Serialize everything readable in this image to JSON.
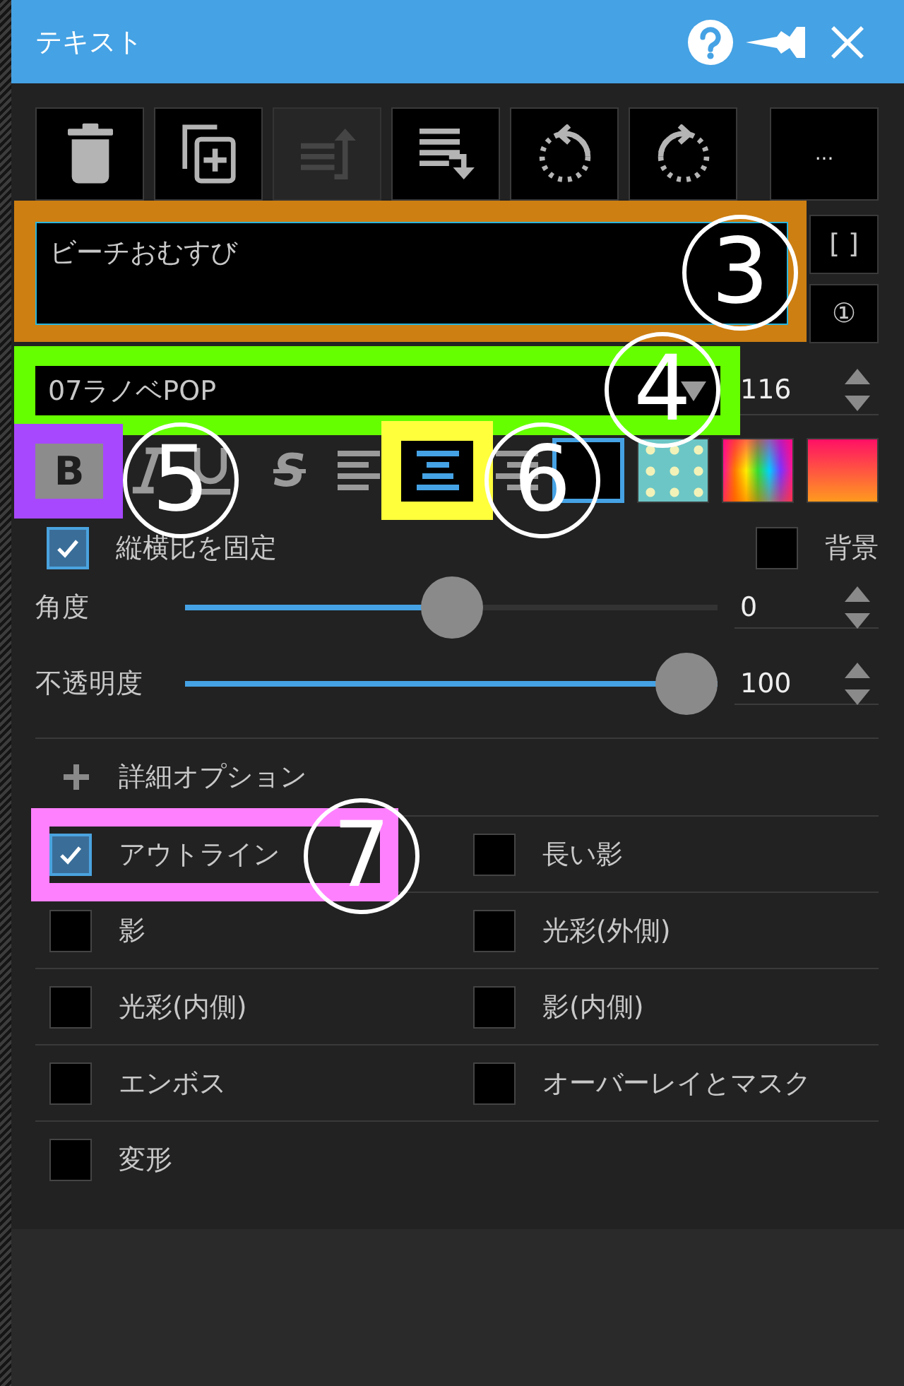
{
  "window": {
    "title": "テキスト"
  },
  "toolbar": {
    "buttons": [
      {
        "kind": "delete",
        "disabled": false
      },
      {
        "kind": "duplicate",
        "disabled": false
      },
      {
        "kind": "bring-forward",
        "disabled": true
      },
      {
        "kind": "send-backward",
        "disabled": false
      },
      {
        "kind": "rotate-left",
        "disabled": false
      },
      {
        "kind": "rotate-right",
        "disabled": false
      }
    ],
    "more": "..."
  },
  "text_input": {
    "value": "ビーチおむすび",
    "annotation": {
      "number": "3",
      "color": "#cd7f12"
    }
  },
  "side_buttons": [
    "[ ]",
    "①"
  ],
  "font": {
    "value": "07ラノベPOP",
    "size": "116",
    "annotation": {
      "number": "4",
      "color": "#66ff00"
    }
  },
  "style_buttons": [
    {
      "kind": "bold",
      "label": "B",
      "on": true,
      "annotation": {
        "number": "5",
        "color": "#a748ff"
      }
    },
    {
      "kind": "italic",
      "on": false
    },
    {
      "kind": "underline",
      "on": false
    },
    {
      "kind": "strikethrough",
      "label": "S",
      "on": false
    }
  ],
  "align_buttons": [
    {
      "kind": "left",
      "selected": false
    },
    {
      "kind": "center",
      "selected": true,
      "annotation": {
        "number": "6",
        "color": "#ffff3c"
      }
    },
    {
      "kind": "right",
      "selected": false
    }
  ],
  "fill_swatches": [
    {
      "kind": "solid",
      "selected": true
    },
    {
      "kind": "dots",
      "selected": false
    },
    {
      "kind": "rainbow",
      "selected": false
    },
    {
      "kind": "gradient",
      "selected": false
    }
  ],
  "lock_aspect": {
    "label": "縦横比を固定",
    "checked": true
  },
  "background": {
    "label": "背景",
    "checked": false
  },
  "sliders": [
    {
      "label": "角度",
      "level": 0.5,
      "value": "0"
    },
    {
      "label": "不透明度",
      "level": 1,
      "value": "100"
    }
  ],
  "advanced": {
    "label": "詳細オプション"
  },
  "options": [
    {
      "label": "アウトライン",
      "checked": true,
      "annotation": {
        "number": "7",
        "color": "#ff80ff"
      }
    },
    {
      "label": "長い影",
      "checked": false
    },
    {
      "label": "影",
      "checked": false
    },
    {
      "label": "光彩(外側)",
      "checked": false
    },
    {
      "label": "光彩(内側)",
      "checked": false
    },
    {
      "label": "影(内側)",
      "checked": false
    },
    {
      "label": "エンボス",
      "checked": false
    },
    {
      "label": "オーバーレイとマスク",
      "checked": false
    },
    {
      "label": "変形",
      "checked": false
    }
  ]
}
